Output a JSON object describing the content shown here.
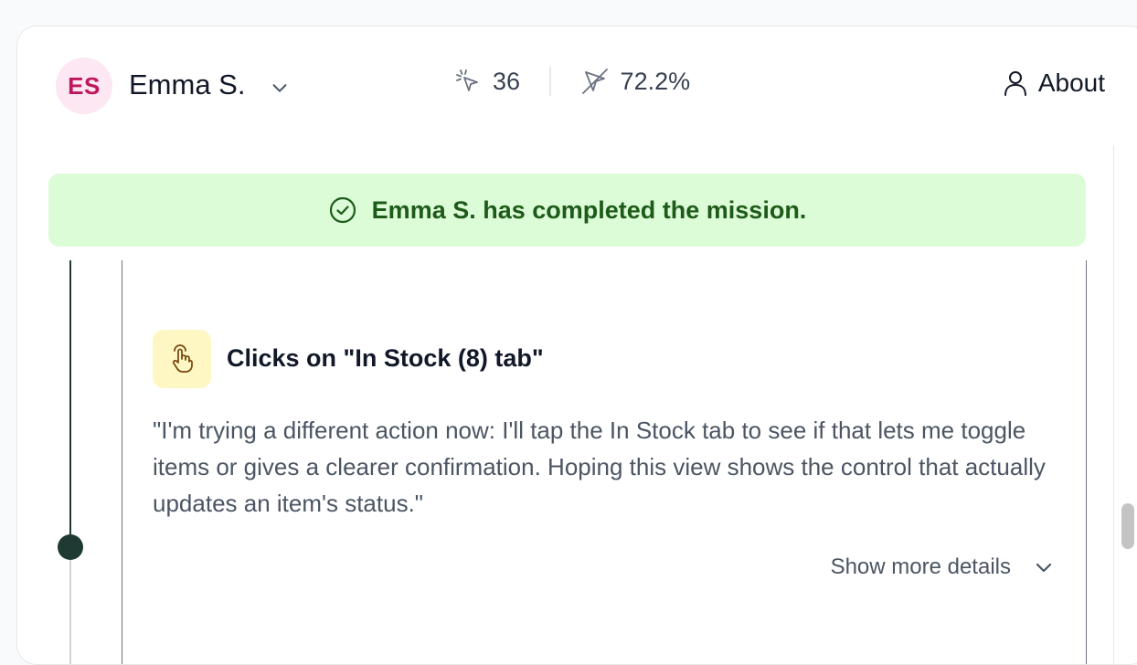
{
  "header": {
    "avatar_initials": "ES",
    "user_name": "Emma S.",
    "stats": {
      "clicks": "36",
      "misclick_rate": "72.2%"
    },
    "about_label": "About"
  },
  "banner": {
    "message": "Emma S. has completed the mission."
  },
  "step": {
    "title": "Clicks on \"In Stock (8) tab\"",
    "description": "\"I'm trying a different action now: I'll tap the In Stock tab to see if that lets me toggle items or gives a clearer confirmation. Hoping this view shows the control that actually updates an item's status.\"",
    "show_more_label": "Show more details"
  },
  "colors": {
    "avatar_bg": "#fce7f3",
    "avatar_text": "#be185d",
    "banner_bg": "#dcfcd7",
    "banner_text": "#1e5a1a",
    "action_icon_bg": "#fef7c3",
    "timeline": "#1f3a33"
  },
  "icons": {
    "clicks": "click-cursor-icon",
    "misclicks": "misclick-cursor-icon",
    "about": "user-icon",
    "banner": "check-circle-icon",
    "action": "tap-hand-icon",
    "expand": "chevron-down-icon"
  }
}
